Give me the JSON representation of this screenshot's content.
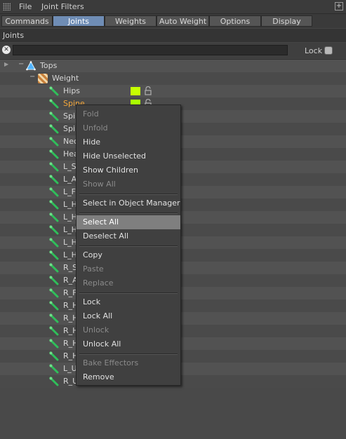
{
  "menubar": {
    "items": [
      "File",
      "Joint Filters"
    ],
    "pin_icon": "+"
  },
  "tabs": [
    {
      "label": "Commands",
      "active": false
    },
    {
      "label": "Joints",
      "active": true
    },
    {
      "label": "Weights",
      "active": false
    },
    {
      "label": "Auto Weight",
      "active": false
    },
    {
      "label": "Options",
      "active": false
    },
    {
      "label": "Display",
      "active": false
    }
  ],
  "section": {
    "title": "Joints"
  },
  "filter": {
    "search_value": "",
    "lock_label": "Lock",
    "lock_checked": false
  },
  "tree": {
    "root": {
      "label": "Tops",
      "icon": "mesh-object-icon"
    },
    "tag": {
      "label": "Weight",
      "icon": "weight-tag-icon"
    },
    "joints": [
      {
        "label": "Hips",
        "color": "#c6ff00"
      },
      {
        "label": "Spine",
        "color": "#aaff00",
        "selected": true
      },
      {
        "label": "Spi",
        "color": ""
      },
      {
        "label": "Spi",
        "color": ""
      },
      {
        "label": "Nec",
        "color": ""
      },
      {
        "label": "Hea",
        "color": ""
      },
      {
        "label": "L_Sl",
        "color": ""
      },
      {
        "label": "L_A",
        "color": ""
      },
      {
        "label": "L_Fo",
        "color": ""
      },
      {
        "label": "L_H",
        "color": ""
      },
      {
        "label": "L_H",
        "color": ""
      },
      {
        "label": "L_H",
        "color": ""
      },
      {
        "label": "L_H",
        "color": ""
      },
      {
        "label": "L_H",
        "color": ""
      },
      {
        "label": "R_S",
        "color": ""
      },
      {
        "label": "R_A",
        "color": ""
      },
      {
        "label": "R_F",
        "color": ""
      },
      {
        "label": "R_H",
        "color": ""
      },
      {
        "label": "R_H",
        "color": ""
      },
      {
        "label": "R_H",
        "color": ""
      },
      {
        "label": "R_H",
        "color": ""
      },
      {
        "label": "R_H",
        "color": ""
      },
      {
        "label": "L_U",
        "color": ""
      },
      {
        "label": "R_U",
        "color": "#2fd7a0"
      }
    ]
  },
  "context_menu": {
    "items": [
      {
        "label": "Fold",
        "enabled": false
      },
      {
        "label": "Unfold",
        "enabled": false
      },
      {
        "label": "Hide",
        "enabled": true
      },
      {
        "label": "Hide Unselected",
        "enabled": true
      },
      {
        "label": "Show Children",
        "enabled": true
      },
      {
        "label": "Show All",
        "enabled": false
      },
      {
        "separator": true
      },
      {
        "label": "Select in Object Manager",
        "enabled": true
      },
      {
        "separator": true
      },
      {
        "label": "Select All",
        "enabled": true,
        "highlighted": true
      },
      {
        "label": "Deselect All",
        "enabled": true
      },
      {
        "separator": true
      },
      {
        "label": "Copy",
        "enabled": true
      },
      {
        "label": "Paste",
        "enabled": false
      },
      {
        "label": "Replace",
        "enabled": false
      },
      {
        "separator": true
      },
      {
        "label": "Lock",
        "enabled": true
      },
      {
        "label": "Lock All",
        "enabled": true
      },
      {
        "label": "Unlock",
        "enabled": false
      },
      {
        "label": "Unlock All",
        "enabled": true
      },
      {
        "separator": true
      },
      {
        "label": "Bake Effectors",
        "enabled": false
      },
      {
        "label": "Remove",
        "enabled": true
      }
    ]
  },
  "colors": {
    "accent_tab": "#6f8db5",
    "selected_text": "#f3a63a",
    "highlight": "#7f7f7f"
  }
}
